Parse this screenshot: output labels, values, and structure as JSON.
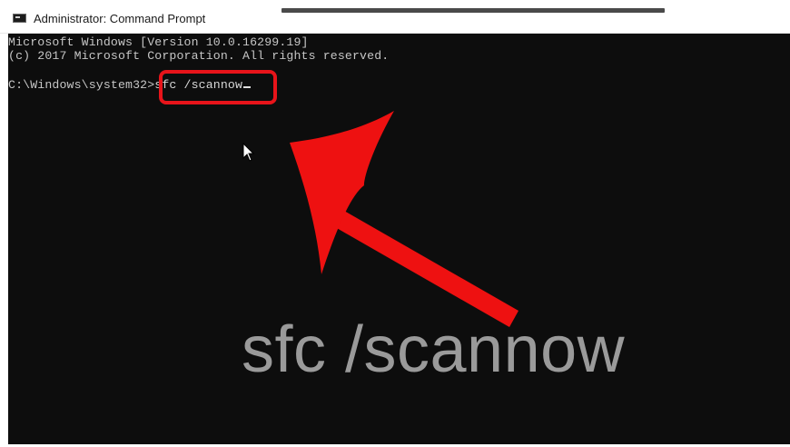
{
  "window": {
    "title": "Administrator: Command Prompt",
    "icon": "cmd-icon"
  },
  "console": {
    "line_1": "Microsoft Windows [Version 10.0.16299.19]",
    "line_2": "(c) 2017 Microsoft Corporation. All rights reserved.",
    "prompt_path": "C:\\Windows\\system32>",
    "command": "sfc /scannow"
  },
  "overlay": {
    "caption": "sfc /scannow",
    "arrow_color": "#e8141a",
    "highlight_color": "#e8141a",
    "caption_color": "#9a9a9a"
  },
  "icons": {
    "pointer": "mouse-pointer-icon",
    "arrow": "red-arrow-icon"
  }
}
